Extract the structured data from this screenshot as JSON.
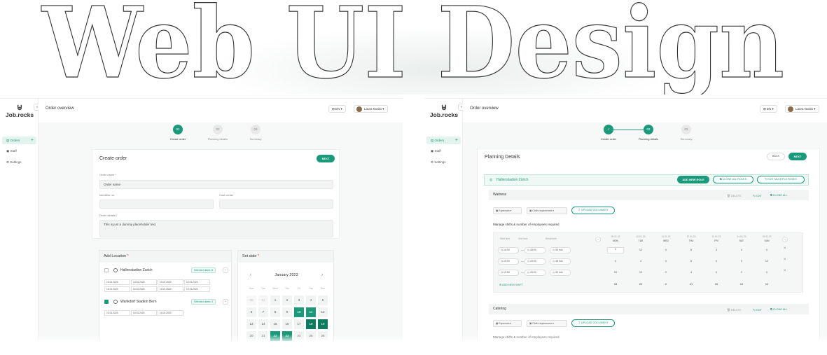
{
  "hero": {
    "title": "Web UI Design"
  },
  "app": {
    "brand": "Job.rocks",
    "nav": [
      {
        "label": "Orders",
        "active": true
      },
      {
        "label": "Staff",
        "active": false
      },
      {
        "label": "Settings",
        "active": false
      }
    ],
    "page_title": "Order overview",
    "lang": "EN",
    "user": "Laura Nordo"
  },
  "steps": [
    {
      "num": "01",
      "label": "Create order"
    },
    {
      "num": "02",
      "label": "Planning details"
    },
    {
      "num": "03",
      "label": "Summary"
    }
  ],
  "create_order": {
    "title": "Create order",
    "next": "NEXT",
    "order_name_label": "Order name *",
    "order_name_value": "Order name",
    "identifier_label": "Identifier no.",
    "cost_center_label": "Cost center",
    "details_label": "Order details *",
    "details_value": "This is just a dummy placeholder text."
  },
  "add_location": {
    "title": "Add Location",
    "locations": [
      {
        "name": "Hallenstadion Zurich",
        "checked": false,
        "selected": "Selected dates: 8",
        "dates": [
          "10.01.2023",
          "10.01.2023",
          "10.01.2023",
          "10.01.2023",
          "10.01.2023",
          "10.01.2023",
          "10.01.2023",
          "10.01.2023"
        ]
      },
      {
        "name": "Wankdorf Stadion Bern",
        "checked": true,
        "selected": "Selected dates: 3",
        "dates": [
          "10.01.2023",
          "10.01.2023",
          "10.01.2023"
        ]
      }
    ]
  },
  "set_date": {
    "title": "Set date",
    "month": "January 2023",
    "dow": [
      "Mon",
      "Tue",
      "Wed",
      "Thu",
      "Fri",
      "Sat",
      "Sun"
    ],
    "days": [
      [
        "30",
        "31",
        "1",
        "2",
        "3",
        "4",
        "5"
      ],
      [
        "6",
        "7",
        "8",
        "9",
        "10",
        "11",
        "12"
      ],
      [
        "13",
        "14",
        "15",
        "16",
        "17",
        "18",
        "19"
      ],
      [
        "20",
        "21",
        "22",
        "23",
        "24",
        "25",
        "26"
      ]
    ]
  },
  "planning": {
    "title": "Planning Details",
    "back": "BACK",
    "next": "NEXT",
    "location": "Hallenstadion Zürich",
    "add_role": "ADD NEW ROLE",
    "clone_roles": "CLONE ALL ROLES",
    "edit_roles": "EDIT MULTIPLE ROLES",
    "roles": [
      {
        "name": "Waitress"
      },
      {
        "name": "Catering"
      }
    ],
    "delete": "DELETE",
    "edit": "EDIT",
    "clone_all": "CLONE ALL",
    "expenses": "Expenses",
    "cloth": "Cloth requirement",
    "upload": "UPLOAD DOCUMENT",
    "shifts_title": "Manage shifts & number of employees required",
    "col_start": "Start time",
    "col_end": "End time",
    "col_break": "Break time",
    "days": [
      {
        "date": "09.01.23",
        "dow": "MON"
      },
      {
        "date": "10.01.23",
        "dow": "TUE"
      },
      {
        "date": "11.01.23",
        "dow": "WED"
      },
      {
        "date": "12.01.23",
        "dow": "THU"
      },
      {
        "date": "13.01.23",
        "dow": "FRI"
      },
      {
        "date": "14.01.23",
        "dow": "SAT"
      },
      {
        "date": "15.01.23",
        "dow": "SUN"
      }
    ],
    "shifts": [
      {
        "start": "16:00",
        "end": "18:00",
        "brk": "30 min",
        "vals": [
          "4",
          "12",
          "0",
          "8",
          "3",
          "4",
          "0"
        ]
      },
      {
        "start": "15:00",
        "end": "19:00",
        "brk": "45 min",
        "vals": [
          "0",
          "4",
          "0",
          "8",
          "0",
          "0",
          "12"
        ]
      },
      {
        "start": "12:00",
        "end": "15:00",
        "brk": "40 min",
        "vals": [
          "10",
          "10",
          "2",
          "4",
          "0",
          "2",
          "0"
        ]
      }
    ],
    "add_shift": "ADD NEW SHIFT",
    "totals": [
      "18",
      "20",
      "2",
      "21",
      "15",
      "10",
      "12"
    ]
  },
  "colors": {
    "accent": "#1a9a7a"
  }
}
